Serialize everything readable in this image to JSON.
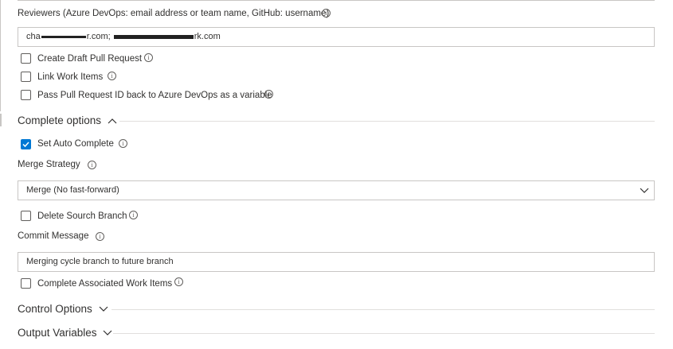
{
  "reviewers": {
    "label": "Reviewers (Azure DevOps: email address or team name, GitHub: username)",
    "value_visible_start": "cha",
    "value_visible_mid": "r.com; ",
    "value_visible_end": "rk.com"
  },
  "checkboxes_top": [
    {
      "label": "Create Draft Pull Request",
      "checked": false
    },
    {
      "label": "Link Work Items",
      "checked": false
    },
    {
      "label": "Pass Pull Request ID back to Azure DevOps as a variable",
      "checked": false
    }
  ],
  "complete_options": {
    "title": "Complete options",
    "set_auto_complete": {
      "label": "Set Auto Complete",
      "checked": true
    },
    "merge_strategy": {
      "label": "Merge Strategy",
      "value": "Merge (No fast-forward)"
    },
    "delete_source_branch": {
      "label": "Delete Sourch Branch",
      "checked": false
    },
    "commit_message": {
      "label": "Commit Message",
      "value": "Merging cycle branch to future branch"
    },
    "complete_associated": {
      "label": "Complete Associated Work Items",
      "checked": false
    }
  },
  "control_options": {
    "title": "Control Options"
  },
  "output_variables": {
    "title": "Output Variables"
  },
  "colors": {
    "accent": "#0078d4",
    "border": "#c8c6c4",
    "text": "#323130"
  }
}
